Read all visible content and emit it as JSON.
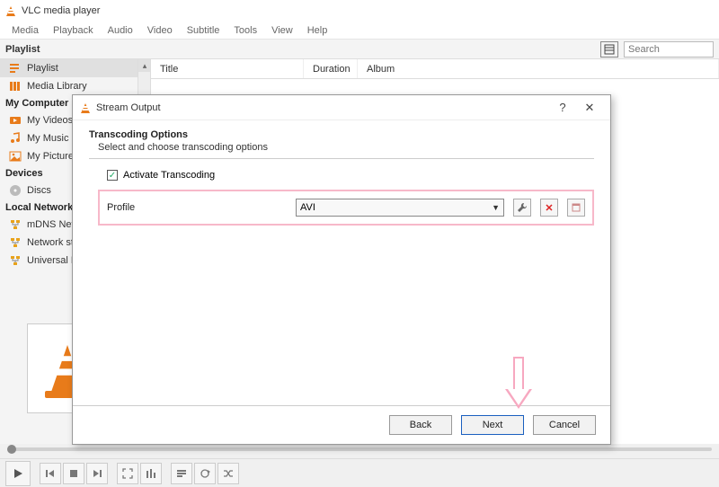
{
  "window": {
    "title": "VLC media player"
  },
  "menu": {
    "items": [
      "Media",
      "Playback",
      "Audio",
      "Video",
      "Subtitle",
      "Tools",
      "View",
      "Help"
    ]
  },
  "playlist_header": {
    "label": "Playlist",
    "search_placeholder": "Search"
  },
  "columns": {
    "title": "Title",
    "duration": "Duration",
    "album": "Album"
  },
  "sidebar": {
    "sections": [
      {
        "label": "",
        "items": [
          {
            "label": "Playlist",
            "icon": "playlist",
            "selected": true
          },
          {
            "label": "Media Library",
            "icon": "library"
          }
        ]
      },
      {
        "label": "My Computer",
        "items": [
          {
            "label": "My Videos",
            "icon": "video"
          },
          {
            "label": "My Music",
            "icon": "music"
          },
          {
            "label": "My Pictures",
            "icon": "picture"
          }
        ]
      },
      {
        "label": "Devices",
        "items": [
          {
            "label": "Discs",
            "icon": "disc"
          }
        ]
      },
      {
        "label": "Local Network",
        "items": [
          {
            "label": "mDNS Network",
            "icon": "net"
          },
          {
            "label": "Network streams",
            "icon": "net"
          },
          {
            "label": "Universal Plug'n'Play",
            "icon": "net"
          }
        ]
      }
    ]
  },
  "modal": {
    "title": "Stream Output",
    "section_title": "Transcoding Options",
    "section_sub": "Select and choose transcoding options",
    "activate_label": "Activate Transcoding",
    "activate_checked": true,
    "profile_label": "Profile",
    "profile_value": "AVI",
    "buttons": {
      "back": "Back",
      "next": "Next",
      "cancel": "Cancel"
    }
  }
}
